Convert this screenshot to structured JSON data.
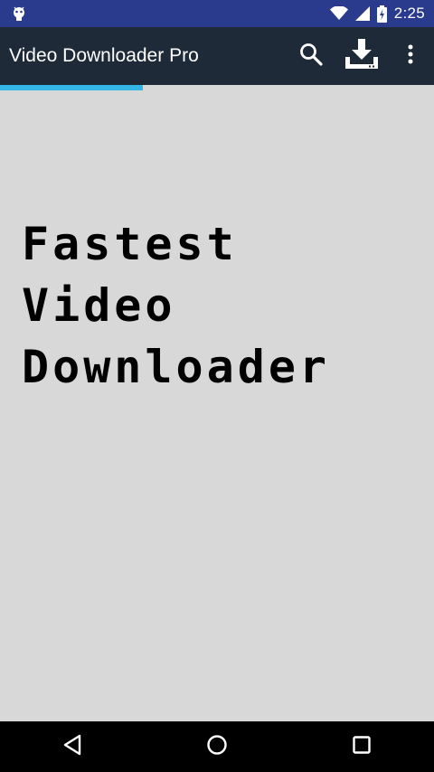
{
  "status_bar": {
    "time": "2:25",
    "icons": [
      "android-debug-icon",
      "wifi-icon",
      "signal-icon",
      "battery-charging-icon"
    ]
  },
  "app_bar": {
    "title": "Video Downloader Pro",
    "actions": [
      "search-icon",
      "download-icon",
      "overflow-menu-icon"
    ]
  },
  "progress": {
    "percent": 33,
    "color": "#33b5e5"
  },
  "content": {
    "headline_lines": [
      "Fastest",
      "Video",
      "Downloader"
    ]
  },
  "nav_bar": {
    "buttons": [
      "back-icon",
      "home-icon",
      "recents-icon"
    ]
  },
  "colors": {
    "status_bar": "#2a3a8c",
    "app_bar": "#1f2a38",
    "background": "#d8d8d8"
  }
}
